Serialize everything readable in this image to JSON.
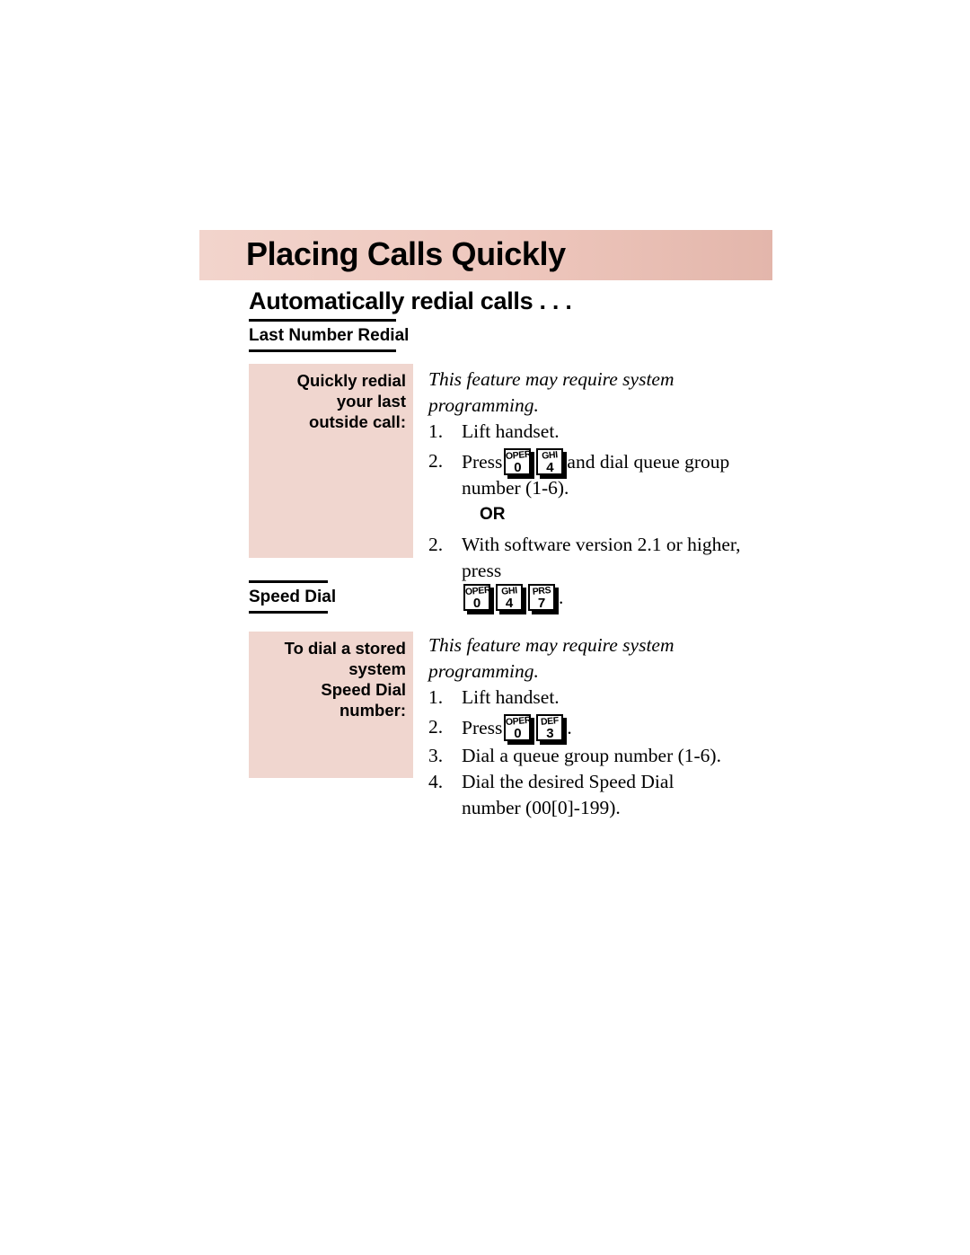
{
  "page": {
    "banner_title": "Placing Calls Quickly",
    "section_heading": "Automatically redial calls . . .",
    "background_color": "#ffffff",
    "banner_color": "#eec7bd",
    "sidebar_color": "#f0d6cf"
  },
  "subsections": [
    {
      "label": "Last Number Redial"
    },
    {
      "label": "Speed Dial"
    }
  ],
  "blocks": [
    {
      "side_label": "Quickly redial your last\noutside call:",
      "intro": "This feature may require system programming.",
      "steps": [
        {
          "num": "1.",
          "text": "Lift handset."
        },
        {
          "num": "2.",
          "pre": "Press",
          "keys": [
            {
              "letters": "OPER",
              "digit": "0"
            },
            {
              "letters": "GHI",
              "digit": "4"
            }
          ],
          "post": "and dial queue group number (1-6)."
        }
      ],
      "or_label": "OR",
      "alt_step": {
        "num": "2.",
        "pre": "With software version 2.1 or higher, press",
        "keys": [
          {
            "letters": "OPER",
            "digit": "0"
          },
          {
            "letters": "GHI",
            "digit": "4"
          },
          {
            "letters": "PRS",
            "digit": "7"
          }
        ],
        "post": "."
      }
    },
    {
      "side_label": "To dial a stored system\nSpeed Dial number:",
      "intro": "This feature may require system programming.",
      "steps": [
        {
          "num": "1.",
          "text": "Lift handset."
        },
        {
          "num": "2.",
          "pre": "Press",
          "keys": [
            {
              "letters": "OPER",
              "digit": "0"
            },
            {
              "letters": "DEF",
              "digit": "3"
            }
          ],
          "post": "."
        },
        {
          "num": "3.",
          "text": "Dial a queue group number (1-6)."
        },
        {
          "num": "4.",
          "text": "Dial the desired Speed Dial number (00[0]-199)."
        }
      ]
    }
  ]
}
